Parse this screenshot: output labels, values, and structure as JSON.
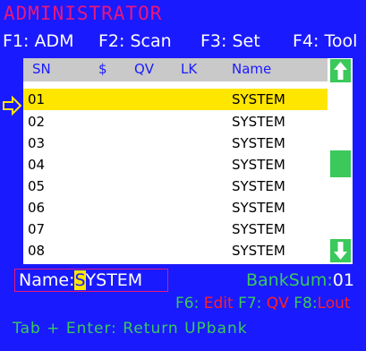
{
  "title": "ADMINISTRATOR",
  "function_keys": [
    {
      "label": "F1: ADM"
    },
    {
      "label": "F2: Scan"
    },
    {
      "label": "F3: Set"
    },
    {
      "label": "F4: Tool"
    }
  ],
  "table": {
    "headers": {
      "sn": "SN",
      "dollar": "$",
      "qv": "QV",
      "lk": "LK",
      "name": "Name"
    },
    "rows": [
      {
        "sn": "01",
        "name": "SYSTEM",
        "selected": true
      },
      {
        "sn": "02",
        "name": "SYSTEM"
      },
      {
        "sn": "03",
        "name": "SYSTEM"
      },
      {
        "sn": "04",
        "name": "SYSTEM"
      },
      {
        "sn": "05",
        "name": "SYSTEM"
      },
      {
        "sn": "06",
        "name": "SYSTEM"
      },
      {
        "sn": "07",
        "name": "SYSTEM"
      },
      {
        "sn": "08",
        "name": "SYSTEM"
      }
    ]
  },
  "name_field": {
    "label": "Name:",
    "cursor_char": "S",
    "rest": "YSTEM"
  },
  "banksum": {
    "label": "BankSum:",
    "value": "01"
  },
  "bottom_keys": {
    "f6_key": "F6:",
    "f6_label": "Edit",
    "f7_key": "F7:",
    "f7_label": "QV",
    "f8_key": "F8:",
    "f8_label": "Lout"
  },
  "footer": "Tab + Enter: Return UPbank",
  "icons": {
    "pointer": "pointer-arrow-icon",
    "scroll_up": "arrow-up-icon",
    "scroll_down": "arrow-down-icon"
  },
  "colors": {
    "background": "#1a1aff",
    "title": "#e8177a",
    "highlight": "#ffe600",
    "green": "#3ac95a",
    "red": "#ff2020"
  }
}
